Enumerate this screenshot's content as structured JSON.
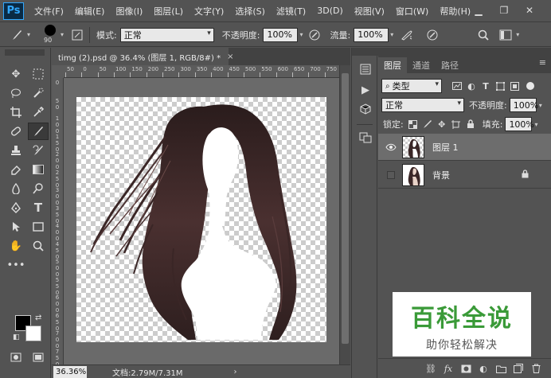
{
  "app": {
    "logo": "Ps",
    "menu": [
      "文件(F)",
      "编辑(E)",
      "图像(I)",
      "图层(L)",
      "文字(Y)",
      "选择(S)",
      "滤镜(T)",
      "3D(D)",
      "视图(V)",
      "窗口(W)",
      "帮助(H)"
    ],
    "window_controls": [
      "minimize-icon",
      "restore-icon",
      "close-icon"
    ]
  },
  "options": {
    "brush_size": "90",
    "mode_label": "模式:",
    "mode_value": "正常",
    "opacity_label": "不透明度:",
    "opacity_value": "100%",
    "flow_label": "流量:",
    "flow_value": "100%"
  },
  "document": {
    "tab_title": "timg (2).psd @ 36.4% (图层 1, RGB/8#) *",
    "tab_close": "×",
    "ruler_h_labels": [
      "50",
      "0",
      "50",
      "100",
      "150",
      "200",
      "250",
      "300",
      "350",
      "400",
      "450",
      "500",
      "550",
      "600",
      "650",
      "700",
      "750"
    ],
    "ruler_v_labels": [
      "0",
      "5\n0",
      "1\n0\n0",
      "1\n5\n0",
      "2\n0\n0",
      "2\n5\n0",
      "3\n0\n0",
      "3\n5\n0",
      "4\n0\n0",
      "4\n5\n0",
      "5\n0\n0",
      "5\n5\n0",
      "6\n0\n0",
      "6\n5\n0",
      "7\n0\n0",
      "7\n5\n0"
    ]
  },
  "status": {
    "zoom": "36.36%",
    "doc_info": "文档:2.79M/7.31M",
    "arrow": "›"
  },
  "panel": {
    "tabs": [
      "图层",
      "通道",
      "路径"
    ],
    "menu_icon": "≡",
    "filter_kind": "类型",
    "blend_mode": "正常",
    "opacity_label": "不透明度:",
    "opacity_value": "100%",
    "lock_label": "锁定:",
    "fill_label": "填充:",
    "fill_value": "100%",
    "layers": [
      {
        "name": "图层 1",
        "visible": true,
        "selected": true,
        "locked": false
      },
      {
        "name": "背景",
        "visible": false,
        "selected": false,
        "locked": true
      }
    ]
  },
  "colors": {
    "foreground": "#000000",
    "background": "#ffffff",
    "ui_bg": "#535353",
    "selected_layer": "#6d6d6d"
  },
  "watermark": {
    "title": "百科全说",
    "subtitle": "助你轻松解决"
  }
}
